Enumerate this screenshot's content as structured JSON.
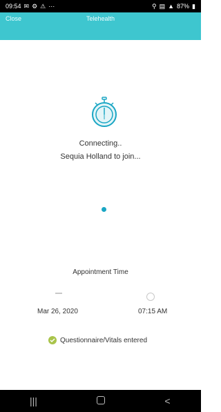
{
  "status_bar": {
    "time": "09:54",
    "left_icons": [
      "message-icon",
      "settings-icon",
      "alert-icon",
      "more-icon"
    ],
    "right_text": "87%",
    "right_icons": [
      "mute-icon",
      "wifi-icon",
      "signal-icon",
      "battery-icon"
    ]
  },
  "header": {
    "back_label": "Close",
    "title": "Telehealth"
  },
  "main": {
    "connecting_text": "Connecting..",
    "waiting_text": "Sequia Holland to join..."
  },
  "appointment": {
    "label": "Appointment Time",
    "date": "Mar 26, 2020",
    "time": "07:15 AM"
  },
  "status": {
    "label": "Questionnaire/Vitals entered"
  },
  "colors": {
    "header": "#3ec6cf",
    "accent": "#1aa6c4",
    "check": "#a9c44b"
  },
  "nav": {
    "recent_label": "|||",
    "back_label": "<"
  }
}
